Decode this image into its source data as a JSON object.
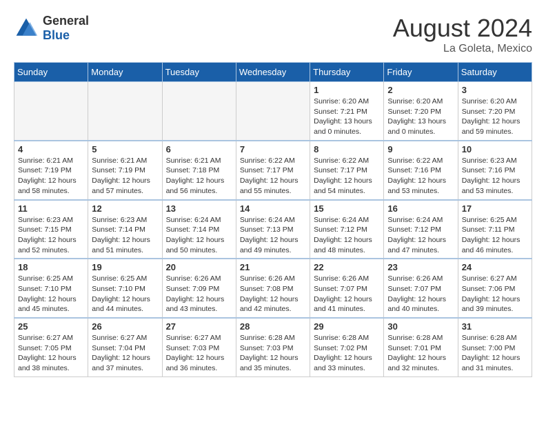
{
  "header": {
    "logo_general": "General",
    "logo_blue": "Blue",
    "month_year": "August 2024",
    "location": "La Goleta, Mexico"
  },
  "weekdays": [
    "Sunday",
    "Monday",
    "Tuesday",
    "Wednesday",
    "Thursday",
    "Friday",
    "Saturday"
  ],
  "weeks": [
    [
      {
        "day": "",
        "info": ""
      },
      {
        "day": "",
        "info": ""
      },
      {
        "day": "",
        "info": ""
      },
      {
        "day": "",
        "info": ""
      },
      {
        "day": "1",
        "info": "Sunrise: 6:20 AM\nSunset: 7:21 PM\nDaylight: 13 hours\nand 0 minutes."
      },
      {
        "day": "2",
        "info": "Sunrise: 6:20 AM\nSunset: 7:20 PM\nDaylight: 13 hours\nand 0 minutes."
      },
      {
        "day": "3",
        "info": "Sunrise: 6:20 AM\nSunset: 7:20 PM\nDaylight: 12 hours\nand 59 minutes."
      }
    ],
    [
      {
        "day": "4",
        "info": "Sunrise: 6:21 AM\nSunset: 7:19 PM\nDaylight: 12 hours\nand 58 minutes."
      },
      {
        "day": "5",
        "info": "Sunrise: 6:21 AM\nSunset: 7:19 PM\nDaylight: 12 hours\nand 57 minutes."
      },
      {
        "day": "6",
        "info": "Sunrise: 6:21 AM\nSunset: 7:18 PM\nDaylight: 12 hours\nand 56 minutes."
      },
      {
        "day": "7",
        "info": "Sunrise: 6:22 AM\nSunset: 7:17 PM\nDaylight: 12 hours\nand 55 minutes."
      },
      {
        "day": "8",
        "info": "Sunrise: 6:22 AM\nSunset: 7:17 PM\nDaylight: 12 hours\nand 54 minutes."
      },
      {
        "day": "9",
        "info": "Sunrise: 6:22 AM\nSunset: 7:16 PM\nDaylight: 12 hours\nand 53 minutes."
      },
      {
        "day": "10",
        "info": "Sunrise: 6:23 AM\nSunset: 7:16 PM\nDaylight: 12 hours\nand 53 minutes."
      }
    ],
    [
      {
        "day": "11",
        "info": "Sunrise: 6:23 AM\nSunset: 7:15 PM\nDaylight: 12 hours\nand 52 minutes."
      },
      {
        "day": "12",
        "info": "Sunrise: 6:23 AM\nSunset: 7:14 PM\nDaylight: 12 hours\nand 51 minutes."
      },
      {
        "day": "13",
        "info": "Sunrise: 6:24 AM\nSunset: 7:14 PM\nDaylight: 12 hours\nand 50 minutes."
      },
      {
        "day": "14",
        "info": "Sunrise: 6:24 AM\nSunset: 7:13 PM\nDaylight: 12 hours\nand 49 minutes."
      },
      {
        "day": "15",
        "info": "Sunrise: 6:24 AM\nSunset: 7:12 PM\nDaylight: 12 hours\nand 48 minutes."
      },
      {
        "day": "16",
        "info": "Sunrise: 6:24 AM\nSunset: 7:12 PM\nDaylight: 12 hours\nand 47 minutes."
      },
      {
        "day": "17",
        "info": "Sunrise: 6:25 AM\nSunset: 7:11 PM\nDaylight: 12 hours\nand 46 minutes."
      }
    ],
    [
      {
        "day": "18",
        "info": "Sunrise: 6:25 AM\nSunset: 7:10 PM\nDaylight: 12 hours\nand 45 minutes."
      },
      {
        "day": "19",
        "info": "Sunrise: 6:25 AM\nSunset: 7:10 PM\nDaylight: 12 hours\nand 44 minutes."
      },
      {
        "day": "20",
        "info": "Sunrise: 6:26 AM\nSunset: 7:09 PM\nDaylight: 12 hours\nand 43 minutes."
      },
      {
        "day": "21",
        "info": "Sunrise: 6:26 AM\nSunset: 7:08 PM\nDaylight: 12 hours\nand 42 minutes."
      },
      {
        "day": "22",
        "info": "Sunrise: 6:26 AM\nSunset: 7:07 PM\nDaylight: 12 hours\nand 41 minutes."
      },
      {
        "day": "23",
        "info": "Sunrise: 6:26 AM\nSunset: 7:07 PM\nDaylight: 12 hours\nand 40 minutes."
      },
      {
        "day": "24",
        "info": "Sunrise: 6:27 AM\nSunset: 7:06 PM\nDaylight: 12 hours\nand 39 minutes."
      }
    ],
    [
      {
        "day": "25",
        "info": "Sunrise: 6:27 AM\nSunset: 7:05 PM\nDaylight: 12 hours\nand 38 minutes."
      },
      {
        "day": "26",
        "info": "Sunrise: 6:27 AM\nSunset: 7:04 PM\nDaylight: 12 hours\nand 37 minutes."
      },
      {
        "day": "27",
        "info": "Sunrise: 6:27 AM\nSunset: 7:03 PM\nDaylight: 12 hours\nand 36 minutes."
      },
      {
        "day": "28",
        "info": "Sunrise: 6:28 AM\nSunset: 7:03 PM\nDaylight: 12 hours\nand 35 minutes."
      },
      {
        "day": "29",
        "info": "Sunrise: 6:28 AM\nSunset: 7:02 PM\nDaylight: 12 hours\nand 33 minutes."
      },
      {
        "day": "30",
        "info": "Sunrise: 6:28 AM\nSunset: 7:01 PM\nDaylight: 12 hours\nand 32 minutes."
      },
      {
        "day": "31",
        "info": "Sunrise: 6:28 AM\nSunset: 7:00 PM\nDaylight: 12 hours\nand 31 minutes."
      }
    ]
  ]
}
